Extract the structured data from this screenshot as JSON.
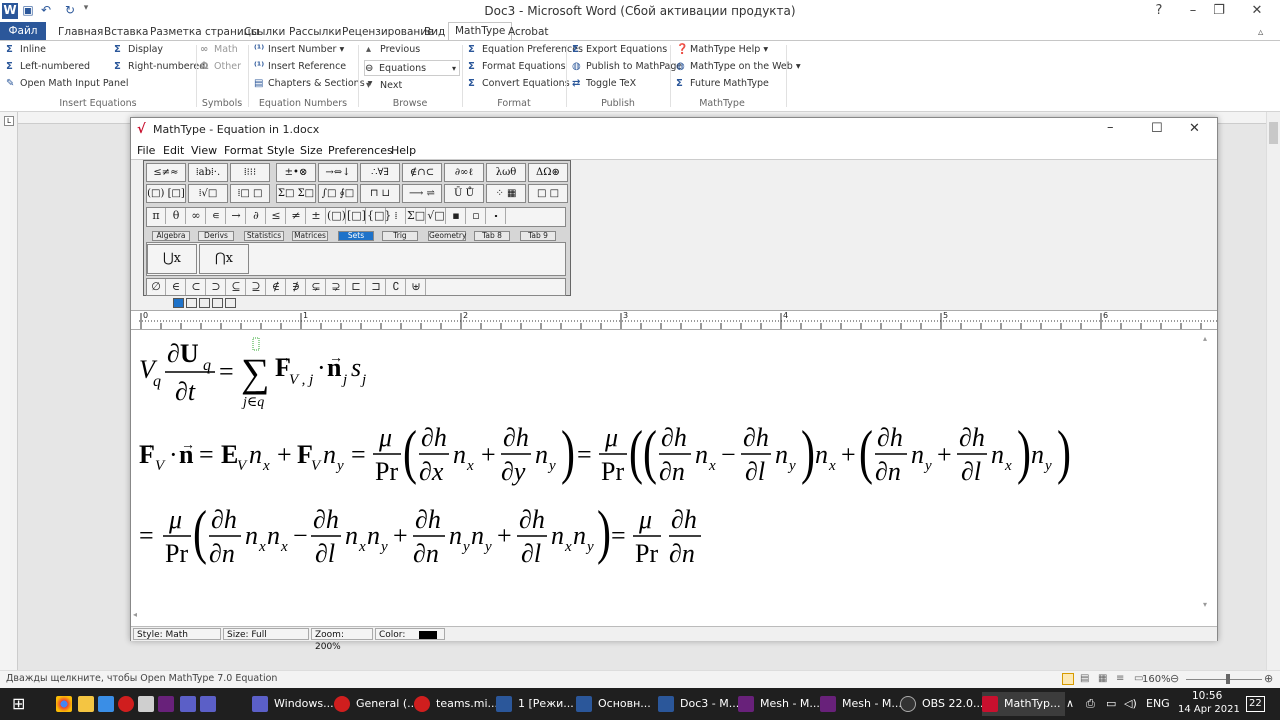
{
  "word": {
    "title": "Doc3 - Microsoft Word (Сбой активации продукта)",
    "tabs": [
      "Файл",
      "Главная",
      "Вставка",
      "Разметка страницы",
      "Ссылки",
      "Рассылки",
      "Рецензирование",
      "Вид",
      "MathType",
      "Acrobat"
    ],
    "ribbon": {
      "insert_equations": {
        "label": "Insert Equations",
        "inline": "Inline",
        "display": "Display",
        "left_numbered": "Left-numbered",
        "right_numbered": "Right-numbered",
        "open_panel": "Open Math Input Panel"
      },
      "symbols": {
        "label": "Symbols",
        "math": "Math",
        "other": "Other"
      },
      "equation_numbers": {
        "label": "Equation Numbers",
        "insert_number": "Insert Number",
        "insert_reference": "Insert Reference",
        "chapters": "Chapters & Sections"
      },
      "browse": {
        "label": "Browse",
        "previous": "Previous",
        "equations": "Equations",
        "next": "Next"
      },
      "format": {
        "label": "Format",
        "equation_preferences": "Equation Preferences",
        "format_equations": "Format Equations",
        "convert_equations": "Convert Equations"
      },
      "publish": {
        "label": "Publish",
        "export_equations": "Export Equations",
        "publish_mathpage": "Publish to MathPage",
        "toggle_tex": "Toggle TeX"
      },
      "mathtype": {
        "label": "MathType",
        "help": "MathType Help",
        "web": "MathType on the Web",
        "future": "Future MathType"
      }
    },
    "status_text": "Дважды щелкните, чтобы Open MathType 7.0 Equation",
    "zoom": "160%"
  },
  "mathtype": {
    "title": "MathType - Equation in 1.docx",
    "menu": [
      "File",
      "Edit",
      "View",
      "Format",
      "Style",
      "Size",
      "Preferences",
      "Help"
    ],
    "palette_row1": [
      "≤≠≈",
      "⁞ab⁞·.",
      "⁞⁝⁝⁝",
      "±•⊗",
      "→⇔↓",
      "∴∀∃",
      "∉∩⊂",
      "∂∞ℓ",
      "λωθ",
      "ΔΩ⊛"
    ],
    "palette_row2": [
      "(□) [□]",
      "⁞√□",
      "⁞□ □",
      "Σ□ Σ□",
      "∫□ ∮□",
      "⊓ ⊔",
      "⟶ ⇌",
      "Ū Ů",
      "⁘ ▦",
      "□ □"
    ],
    "palette_row3": [
      "π",
      "θ",
      "∞",
      "∊",
      "→",
      "∂",
      "≤",
      "≠",
      "±",
      "(□)",
      "[□]",
      "{□}",
      "⁞",
      "Σ□",
      "√□",
      "▪",
      "▫",
      "⬝"
    ],
    "palette_tabs": [
      "Algebra",
      "Derivs",
      "Statistics",
      "Matrices",
      "Sets",
      "Trig",
      "Geometry",
      "Tab 8",
      "Tab 9"
    ],
    "selected_tab": "Sets",
    "sets_templates": [
      "⋃x",
      "⋂x"
    ],
    "palette_row5": [
      "∅",
      "∈",
      "⊂",
      "⊃",
      "⊆",
      "⊇",
      "∉",
      "∌",
      "⊊",
      "⊋",
      "⊏",
      "⊐",
      "∁",
      "⊎"
    ],
    "ruler_labels": [
      "0",
      "1",
      "2",
      "3",
      "4",
      "5",
      "6"
    ],
    "status": {
      "style": "Style: Math",
      "size": "Size: Full",
      "zoom": "Zoom: 200%",
      "color": "Color:"
    }
  },
  "taskbar": {
    "items": [
      "Windows...",
      "General (...",
      "teams.mi...",
      "1 [Режи...",
      "Основн...",
      "Doc3 - M...",
      "Mesh - M...",
      "Mesh - M...",
      "OBS 22.0...",
      "MathTyp..."
    ],
    "lang": "ENG",
    "time": "10:56",
    "date": "14 Apr 2021",
    "notif": "22"
  }
}
